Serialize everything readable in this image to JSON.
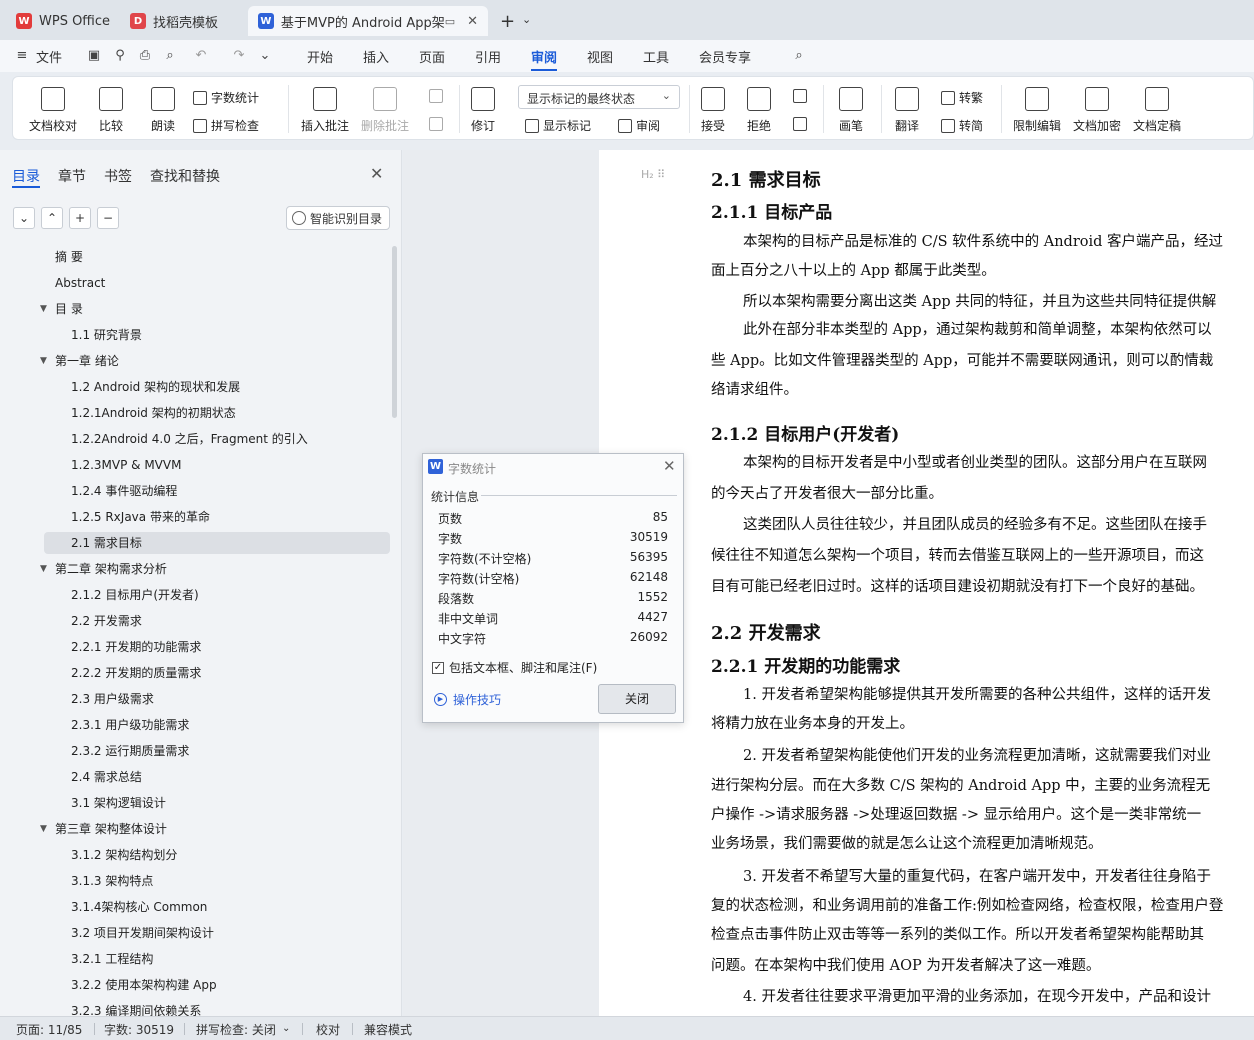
{
  "tabs": [
    {
      "label": "WPS Office",
      "icon": "wps-logo-icon"
    },
    {
      "label": "找稻壳模板",
      "icon": "docer-icon"
    },
    {
      "label": "基于MVP的 Android App架构",
      "icon": "writer-doc-icon"
    }
  ],
  "menu": {
    "file": "文件",
    "items": [
      "开始",
      "插入",
      "页面",
      "引用",
      "审阅",
      "视图",
      "工具",
      "会员专享"
    ],
    "active": "审阅"
  },
  "ribbon": {
    "doc_proof": "文档校对",
    "compare": "比较",
    "read_aloud": "朗读",
    "word_count": "字数统计",
    "spell_check": "拼写检查",
    "insert_comment": "插入批注",
    "delete_comment": "删除批注",
    "revise": "修订",
    "markup_state": "显示标记的最终状态",
    "show_markup": "显示标记",
    "review_pane": "审阅",
    "accept": "接受",
    "reject": "拒绝",
    "ink": "画笔",
    "translate": "翻译",
    "to_traditional": "转繁",
    "to_simplified": "转简",
    "restrict_edit": "限制编辑",
    "encrypt": "文档加密",
    "finalize": "文档定稿"
  },
  "nav": {
    "tabs": [
      "目录",
      "章节",
      "书签",
      "查找和替换"
    ],
    "smart_toc": "智能识别目录",
    "toc": [
      {
        "label": "摘 要",
        "level": 1,
        "caret": false
      },
      {
        "label": "Abstract",
        "level": 1,
        "caret": false
      },
      {
        "label": "目 录",
        "level": 1,
        "caret": true
      },
      {
        "label": "1.1 研究背景",
        "level": 2,
        "caret": false
      },
      {
        "label": "第一章 绪论",
        "level": 1,
        "caret": true
      },
      {
        "label": "1.2 Android 架构的现状和发展",
        "level": 2,
        "caret": false
      },
      {
        "label": "1.2.1Android 架构的初期状态",
        "level": 2,
        "caret": false
      },
      {
        "label": "1.2.2Android 4.0 之后，Fragment 的引入",
        "level": 2,
        "caret": false
      },
      {
        "label": "1.2.3MVP & MVVM",
        "level": 2,
        "caret": false
      },
      {
        "label": "1.2.4 事件驱动编程",
        "level": 2,
        "caret": false
      },
      {
        "label": "1.2.5 RxJava 带来的革命",
        "level": 2,
        "caret": false
      },
      {
        "label": "2.1 需求目标",
        "level": 2,
        "caret": false,
        "selected": true
      },
      {
        "label": "第二章 架构需求分析",
        "level": 1,
        "caret": true
      },
      {
        "label": "2.1.2 目标用户(开发者)",
        "level": 2,
        "caret": false
      },
      {
        "label": "2.2 开发需求",
        "level": 2,
        "caret": false
      },
      {
        "label": "2.2.1 开发期的功能需求",
        "level": 2,
        "caret": false
      },
      {
        "label": "2.2.2 开发期的质量需求",
        "level": 2,
        "caret": false
      },
      {
        "label": "2.3 用户级需求",
        "level": 2,
        "caret": false
      },
      {
        "label": "2.3.1 用户级功能需求",
        "level": 2,
        "caret": false
      },
      {
        "label": "2.3.2 运行期质量需求",
        "level": 2,
        "caret": false
      },
      {
        "label": "2.4 需求总结",
        "level": 2,
        "caret": false
      },
      {
        "label": "3.1 架构逻辑设计",
        "level": 2,
        "caret": false
      },
      {
        "label": "第三章 架构整体设计",
        "level": 1,
        "caret": true
      },
      {
        "label": "3.1.2 架构结构划分",
        "level": 2,
        "caret": false
      },
      {
        "label": "3.1.3 架构特点",
        "level": 2,
        "caret": false
      },
      {
        "label": "3.1.4架构核心 Common",
        "level": 2,
        "caret": false
      },
      {
        "label": "3.2 项目开发期间架构设计",
        "level": 2,
        "caret": false
      },
      {
        "label": "3.2.1 工程结构",
        "level": 2,
        "caret": false
      },
      {
        "label": "3.2.2  使用本架构构建 App",
        "level": 2,
        "caret": false
      },
      {
        "label": "3.2.3 编译期间依赖关系",
        "level": 2,
        "caret": false
      }
    ]
  },
  "document": {
    "marker": "H₂ ⠿",
    "lines": [
      {
        "kind": "h2",
        "text": "2.1  需求目标"
      },
      {
        "kind": "h3",
        "text": "2.1.1  目标产品"
      },
      {
        "kind": "p",
        "text": "本架构的目标产品是标准的  C/S 软件系统中的  Android 客户端产品，经过"
      },
      {
        "kind": "p",
        "text": "面上百分之八十以上的  App  都属于此类型。"
      },
      {
        "kind": "p",
        "text": "所以本架构需要分离出这类  App  共同的特征，并且为这些共同特征提供解"
      },
      {
        "kind": "p",
        "text": "此外在部分非本类型的  App，通过架构裁剪和简单调整，本架构依然可以"
      },
      {
        "kind": "p",
        "text": "些  App。比如文件管理器类型的  App，可能并不需要联网通讯，则可以酌情裁"
      },
      {
        "kind": "p",
        "text": "络请求组件。"
      },
      {
        "kind": "h3",
        "text": "2.1.2  目标用户(开发者)"
      },
      {
        "kind": "p",
        "text": "本架构的目标开发者是中小型或者创业类型的团队。这部分用户在互联网"
      },
      {
        "kind": "p",
        "text": "的今天占了开发者很大一部分比重。"
      },
      {
        "kind": "p",
        "text": "这类团队人员往往较少，并且团队成员的经验多有不足。这些团队在接手"
      },
      {
        "kind": "p",
        "text": "候往往不知道怎么架构一个项目，转而去借鉴互联网上的一些开源项目，而这"
      },
      {
        "kind": "p",
        "text": "目有可能已经老旧过时。这样的话项目建设初期就没有打下一个良好的基础。"
      },
      {
        "kind": "h2",
        "text": "2.2  开发需求"
      },
      {
        "kind": "h3",
        "text": "2.2.1  开发期的功能需求"
      },
      {
        "kind": "p",
        "text": "1. 开发者希望架构能够提供其开发所需要的各种公共组件，这样的话开发"
      },
      {
        "kind": "p",
        "text": "将精力放在业务本身的开发上。"
      },
      {
        "kind": "p",
        "text": "2. 开发者希望架构能使他们开发的业务流程更加清晰，这就需要我们对业"
      },
      {
        "kind": "p",
        "text": "进行架构分层。而在大多数  C/S 架构的  Android App  中，主要的业务流程无"
      },
      {
        "kind": "p",
        "text": "户操作  ->请求服务器  ->处理返回数据  -> 显示给用户。这个是一类非常统一"
      },
      {
        "kind": "p",
        "text": "业务场景，我们需要做的就是怎么让这个流程更加清晰规范。"
      },
      {
        "kind": "p",
        "text": "3. 开发者不希望写大量的重复代码，在客户端开发中，开发者往往身陷于"
      },
      {
        "kind": "p",
        "text": "复的状态检测，和业务调用前的准备工作:例如检查网络，检查权限，检查用户登"
      },
      {
        "kind": "p",
        "text": "检查点击事件防止双击等等一系列的类似工作。所以开发者希望架构能帮助其"
      },
      {
        "kind": "p",
        "text": "问题。在本架构中我们使用  AOP 为开发者解决了这一难题。"
      },
      {
        "kind": "p",
        "text": "4.  开发者往往要求平滑更加平滑的业务添加，在现今开发中，产品和设计"
      }
    ]
  },
  "dialog": {
    "title": "字数统计",
    "section": "统计信息",
    "stats": [
      {
        "label": "页数",
        "value": "85"
      },
      {
        "label": "字数",
        "value": "30519"
      },
      {
        "label": "字符数(不计空格)",
        "value": "56395"
      },
      {
        "label": "字符数(计空格)",
        "value": "62148"
      },
      {
        "label": "段落数",
        "value": "1552"
      },
      {
        "label": "非中文单词",
        "value": "4427"
      },
      {
        "label": "中文字符",
        "value": "26092"
      }
    ],
    "include_label": "包括文本框、脚注和尾注(F)",
    "include_checked": true,
    "tips": "操作技巧",
    "close": "关闭"
  },
  "status": {
    "page": "页面: 11/85",
    "words": "字数: 30519",
    "spell": "拼写检查: 关闭",
    "proof": "校对",
    "compat": "兼容模式"
  },
  "colors": {
    "accent": "#1a5bd8",
    "wps_red": "#e23b3b",
    "writer_blue": "#2f62d8"
  }
}
